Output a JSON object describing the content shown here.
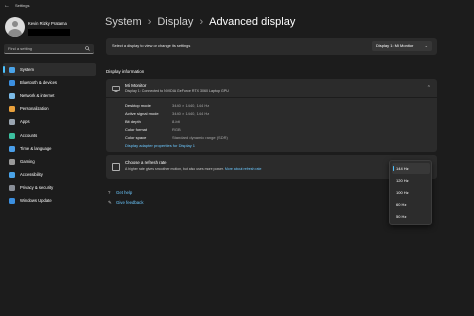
{
  "window": {
    "title": "Settings",
    "back_glyph": "←"
  },
  "user": {
    "name": "Kevin Rizky Pratama"
  },
  "search": {
    "placeholder": "Find a setting"
  },
  "sidebar": {
    "items": [
      {
        "label": "System",
        "icon": "monitor-icon",
        "color": "#4aa3e8",
        "active": true
      },
      {
        "label": "Bluetooth & devices",
        "icon": "bluetooth-icon",
        "color": "#3b8fe0"
      },
      {
        "label": "Network & internet",
        "icon": "network-icon",
        "color": "#7bbbe8"
      },
      {
        "label": "Personalization",
        "icon": "brush-icon",
        "color": "#e8a03c"
      },
      {
        "label": "Apps",
        "icon": "apps-icon",
        "color": "#9aa5b1"
      },
      {
        "label": "Accounts",
        "icon": "person-icon",
        "color": "#3cc0a0"
      },
      {
        "label": "Time & language",
        "icon": "globe-clock-icon",
        "color": "#4a9ee8"
      },
      {
        "label": "Gaming",
        "icon": "gamepad-icon",
        "color": "#9a9a9a"
      },
      {
        "label": "Accessibility",
        "icon": "accessibility-icon",
        "color": "#4aa3e8"
      },
      {
        "label": "Privacy & security",
        "icon": "shield-icon",
        "color": "#8a8f98"
      },
      {
        "label": "Windows Update",
        "icon": "update-icon",
        "color": "#3b8fe0"
      }
    ]
  },
  "breadcrumb": {
    "parent1": "System",
    "parent2": "Display",
    "current": "Advanced display",
    "sep": "›"
  },
  "monitor_select": {
    "label": "Select a display to view or change its settings",
    "value": "Display 1: Mi Monitor",
    "chevron": "⌄"
  },
  "display_info": {
    "section_title": "Display information",
    "monitor_name": "Mi Monitor",
    "subtitle": "Display 1: Connected to NVIDIA GeForce RTX 3060 Laptop GPU",
    "chevron": "⌃",
    "rows": [
      {
        "key": "Desktop mode",
        "value": "3440 × 1440, 144 Hz"
      },
      {
        "key": "Active signal mode",
        "value": "3440 × 1440, 144 Hz"
      },
      {
        "key": "Bit depth",
        "value": "8-bit"
      },
      {
        "key": "Color format",
        "value": "RGB"
      },
      {
        "key": "Color space",
        "value": "Standard dynamic range (SDR)"
      }
    ],
    "adapter_link": "Display adapter properties for Display 1"
  },
  "refresh_rate": {
    "title": "Choose a refresh rate",
    "description": "A higher rate gives smoother motion, but also uses more power.",
    "more_link": "More about refresh rate",
    "options": [
      {
        "label": "144 Hz",
        "selected": true
      },
      {
        "label": "120 Hz"
      },
      {
        "label": "100 Hz"
      },
      {
        "label": "60 Hz"
      },
      {
        "label": "50 Hz"
      }
    ]
  },
  "footer": {
    "get_help": "Get help",
    "give_feedback": "Give feedback"
  },
  "colors": {
    "accent": "#4cc2ff",
    "link": "#6cc8ff",
    "background": "#1c1c1c",
    "card": "#2b2b2b"
  }
}
